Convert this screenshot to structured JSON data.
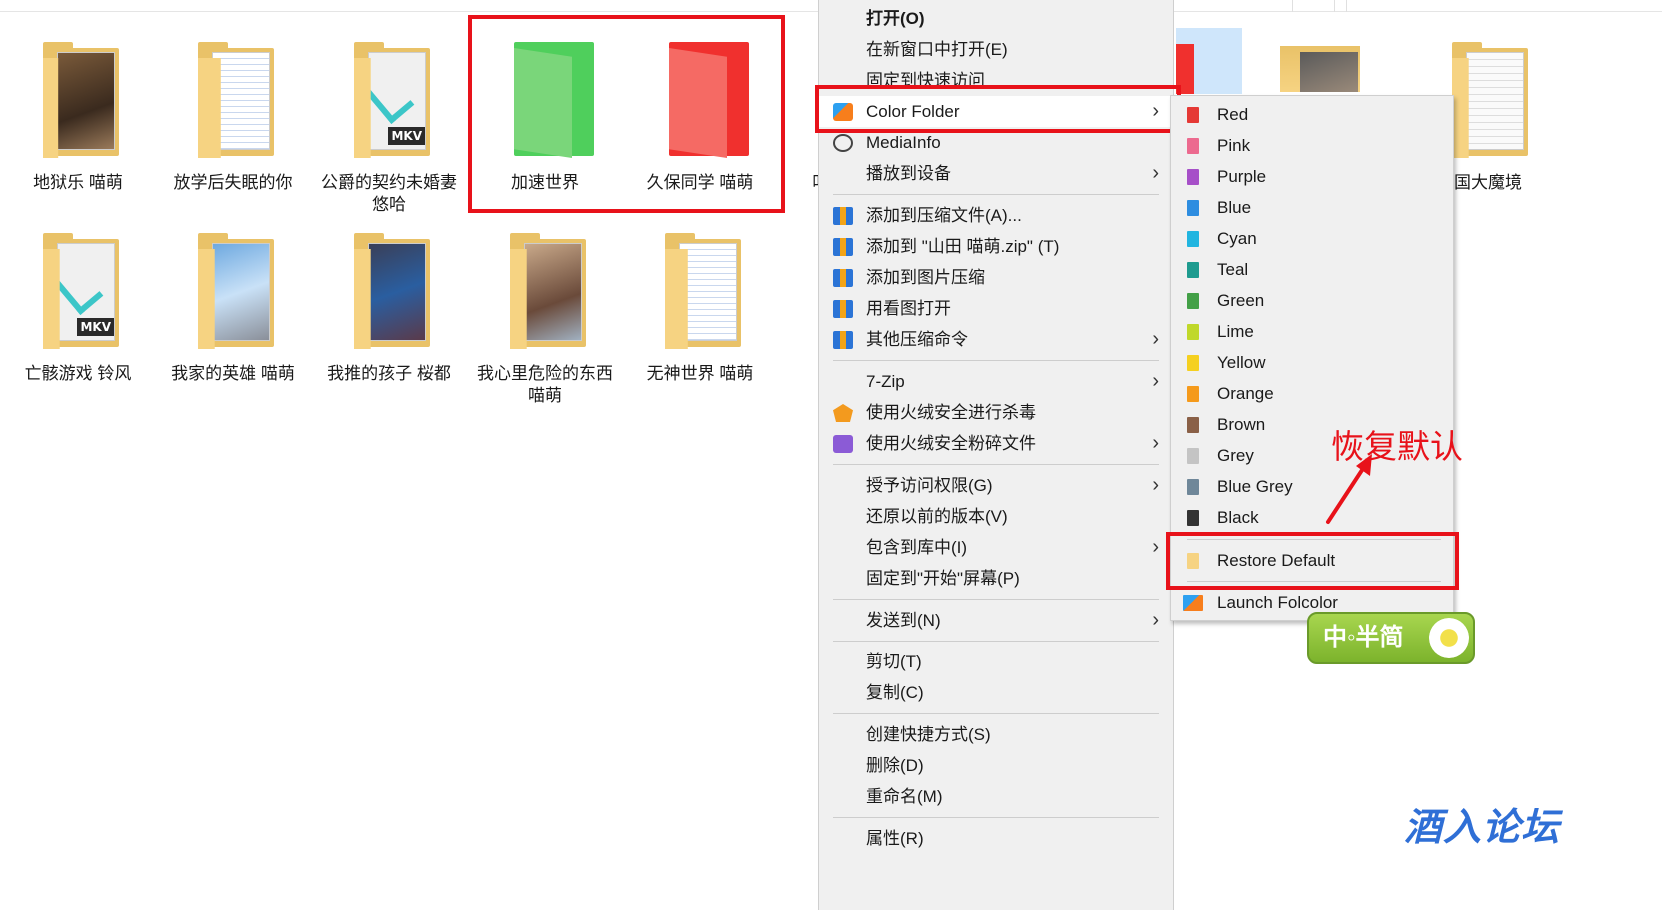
{
  "folders": [
    {
      "label": "地狱乐 喵萌",
      "kind": "dark"
    },
    {
      "label": "放学后失眠的你",
      "kind": "paper"
    },
    {
      "label": "公爵的契约未婚妻 悠哈",
      "kind": "mkv"
    },
    {
      "label": "加速世界",
      "kind": "green"
    },
    {
      "label": "久保同学 喵萌",
      "kind": "red"
    },
    {
      "label": "亡骸游戏 铃风",
      "kind": "mkv"
    },
    {
      "label": "我家的英雄 喵萌",
      "kind": "sky"
    },
    {
      "label": "我推的孩子 桜都",
      "kind": "night"
    },
    {
      "label": "我心里危险的东西 喵萌",
      "kind": "room"
    },
    {
      "label": "无神世界 喵萌",
      "kind": "paper"
    }
  ],
  "partial_labels": {
    "left_cut": "叫",
    "right": "国大魔境"
  },
  "mkv_badge": "MKV",
  "context_menu": {
    "open": "打开(O)",
    "open_new_window": "在新窗口中打开(E)",
    "pin_quick_access": "固定到快速访问",
    "color_folder": "Color Folder",
    "mediainfo": "MediaInfo",
    "play_to_device": "播放到设备",
    "add_archive": "添加到压缩文件(A)...",
    "add_to_zip": "添加到 \"山田 喵萌.zip\" (T)",
    "add_image_compress": "添加到图片压缩",
    "open_with_viewer": "用看图打开",
    "other_compress": "其他压缩命令",
    "seven_zip": "7-Zip",
    "huorong_scan": "使用火绒安全进行杀毒",
    "huorong_shred": "使用火绒安全粉碎文件",
    "grant_access": "授予访问权限(G)",
    "restore_previous": "还原以前的版本(V)",
    "include_library": "包含到库中(I)",
    "pin_start": "固定到\"开始\"屏幕(P)",
    "send_to": "发送到(N)",
    "cut": "剪切(T)",
    "copy": "复制(C)",
    "create_shortcut": "创建快捷方式(S)",
    "delete": "删除(D)",
    "rename": "重命名(M)",
    "properties": "属性(R)"
  },
  "color_submenu": {
    "items": [
      {
        "label": "Red",
        "color": "#e53935"
      },
      {
        "label": "Pink",
        "color": "#ec6a8f"
      },
      {
        "label": "Purple",
        "color": "#a64fc8"
      },
      {
        "label": "Blue",
        "color": "#2e8de0"
      },
      {
        "label": "Cyan",
        "color": "#21b5e0"
      },
      {
        "label": "Teal",
        "color": "#1e9b8f"
      },
      {
        "label": "Green",
        "color": "#43a047"
      },
      {
        "label": "Lime",
        "color": "#c0d82a"
      },
      {
        "label": "Yellow",
        "color": "#f5d020"
      },
      {
        "label": "Orange",
        "color": "#f59a1b"
      },
      {
        "label": "Brown",
        "color": "#8a6047"
      },
      {
        "label": "Grey",
        "color": "#c4c4c4"
      },
      {
        "label": "Blue Grey",
        "color": "#6f8799"
      },
      {
        "label": "Black",
        "color": "#333333"
      }
    ],
    "restore_default": "Restore Default",
    "launch": "Launch Folcolor"
  },
  "annotation": "恢复默认",
  "ime_label": "中◦半简",
  "watermark": "酒入论坛",
  "colors": {
    "highlight_box": "#e8121a",
    "green_folder": "#3fbf50",
    "red_folder": "#f0302e"
  }
}
